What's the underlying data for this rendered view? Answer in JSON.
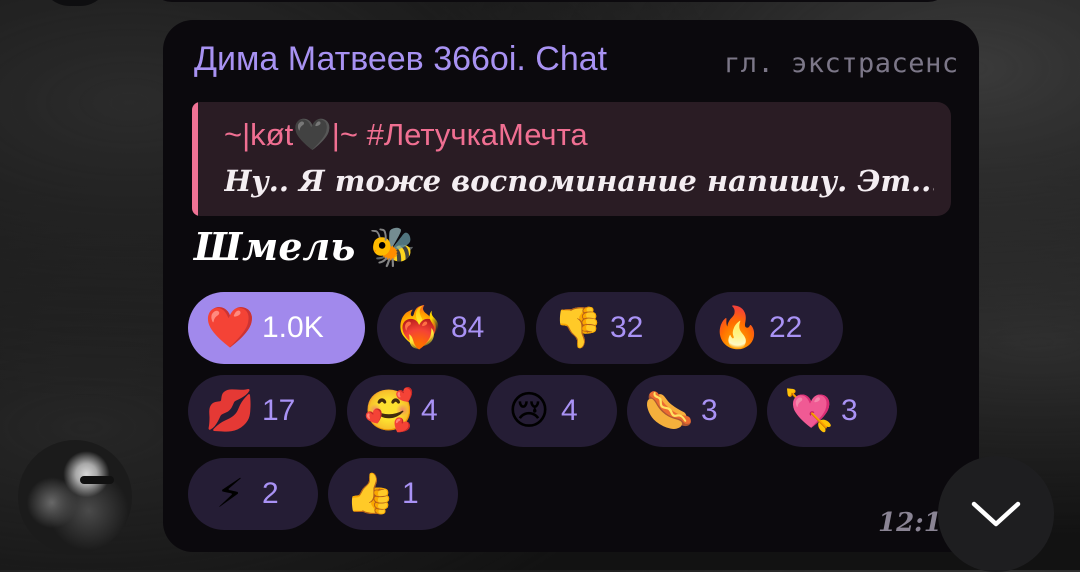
{
  "message": {
    "sender_name": "Дима Матвеев 366oi. Chat",
    "sender_rank": "гл. экстрасенс",
    "reply": {
      "author": "~|køt🖤|~ #ЛетучкаМечта",
      "text": "Ну.. Я тоже воспоминание напишу.    Эт..."
    },
    "text": "Шмель",
    "text_emoji": "🐝",
    "time": "12:1"
  },
  "reactions": [
    {
      "emoji": "❤️",
      "count": "1.0K",
      "selected": true
    },
    {
      "emoji": "❤️‍🔥",
      "count": "84",
      "selected": false
    },
    {
      "emoji": "👎",
      "count": "32",
      "selected": false
    },
    {
      "emoji": "🔥",
      "count": "22",
      "selected": false
    },
    {
      "emoji": "💋",
      "count": "17",
      "selected": false
    },
    {
      "emoji": "🥰",
      "count": "4",
      "selected": false
    },
    {
      "emoji": "😢",
      "count": "4",
      "selected": false
    },
    {
      "emoji": "🌭",
      "count": "3",
      "selected": false
    },
    {
      "emoji": "💘",
      "count": "3",
      "selected": false
    },
    {
      "emoji": "⚡",
      "count": "2",
      "selected": false
    },
    {
      "emoji": "👍",
      "count": "1",
      "selected": false
    }
  ],
  "icons": {
    "scroll_down": "chevron-down-icon",
    "avatar": "user-avatar"
  },
  "colors": {
    "sender": "#a892f2",
    "reply_accent": "#f07395",
    "selected_reaction": "#a189ec",
    "reaction_bg": "#251d35"
  }
}
